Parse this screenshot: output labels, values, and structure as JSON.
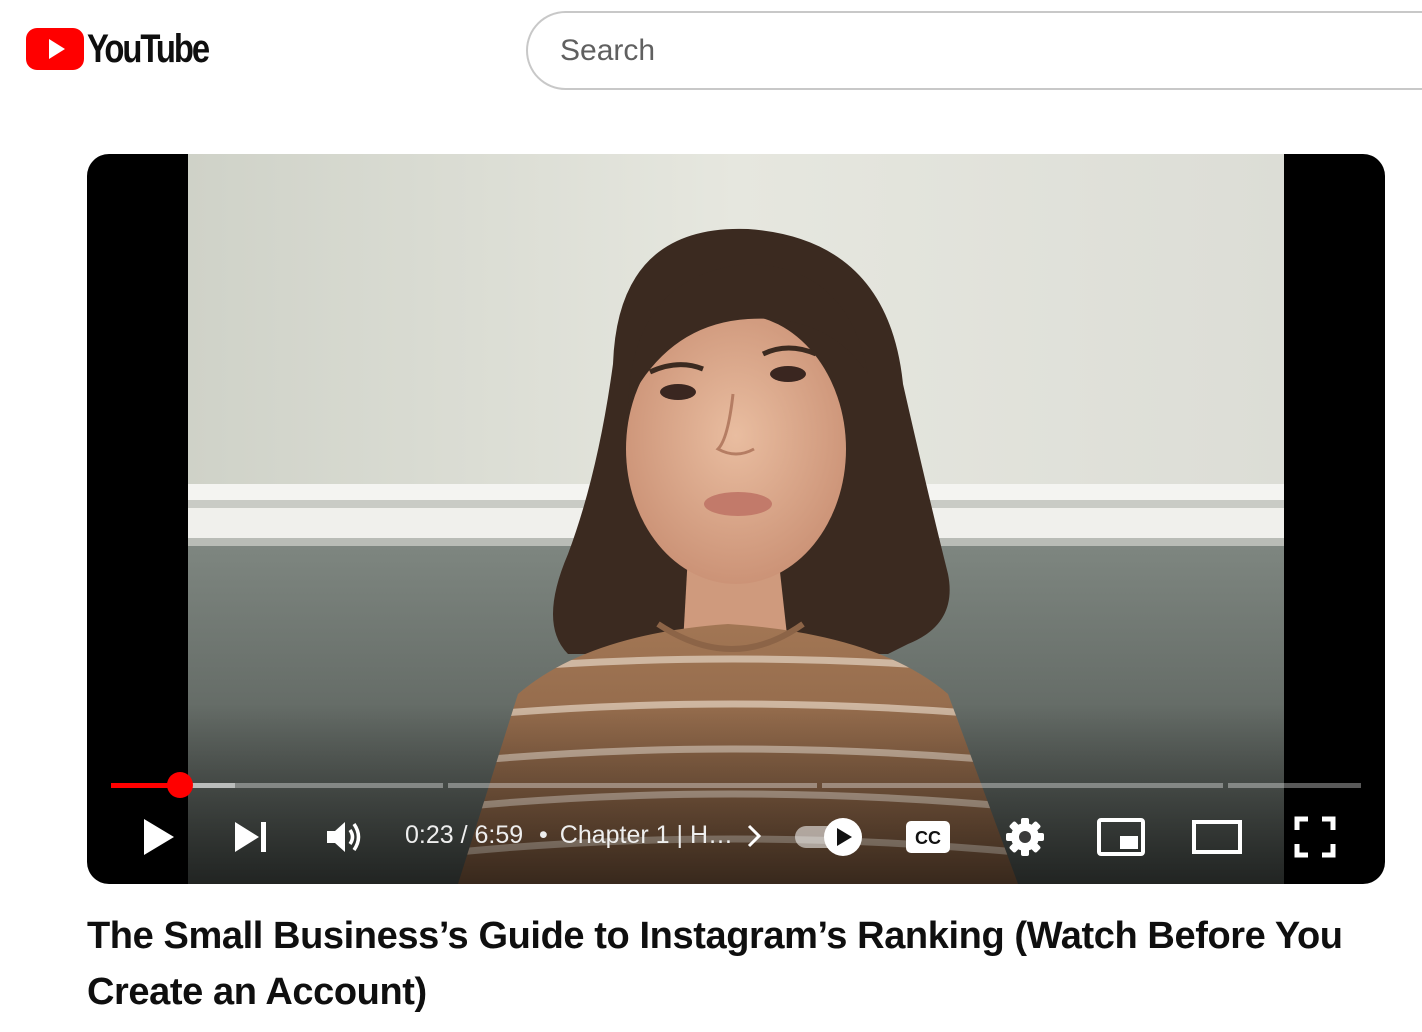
{
  "header": {
    "logo_text": "YouTube",
    "search_placeholder": "Search",
    "brand_color": "#ff0000"
  },
  "player": {
    "current_time": "0:23",
    "duration": "6:59",
    "time_display": "0:23 / 6:59",
    "chapter_separator": "•",
    "chapter_label": "Chapter 1 | H…",
    "progress_played_fraction": 0.055,
    "progress_buffered_fraction": 0.099,
    "autoplay": "on",
    "icons": [
      "play-icon",
      "next-icon",
      "volume-icon",
      "chevron-right-icon",
      "autoplay-toggle-icon",
      "subtitles-cc-icon",
      "settings-gear-icon",
      "miniplayer-icon",
      "theater-mode-icon",
      "fullscreen-icon"
    ],
    "cc_label": "CC"
  },
  "video": {
    "title": "The Small Business’s Guide to Instagram’s Ranking (Watch Before You Create an Account)"
  }
}
